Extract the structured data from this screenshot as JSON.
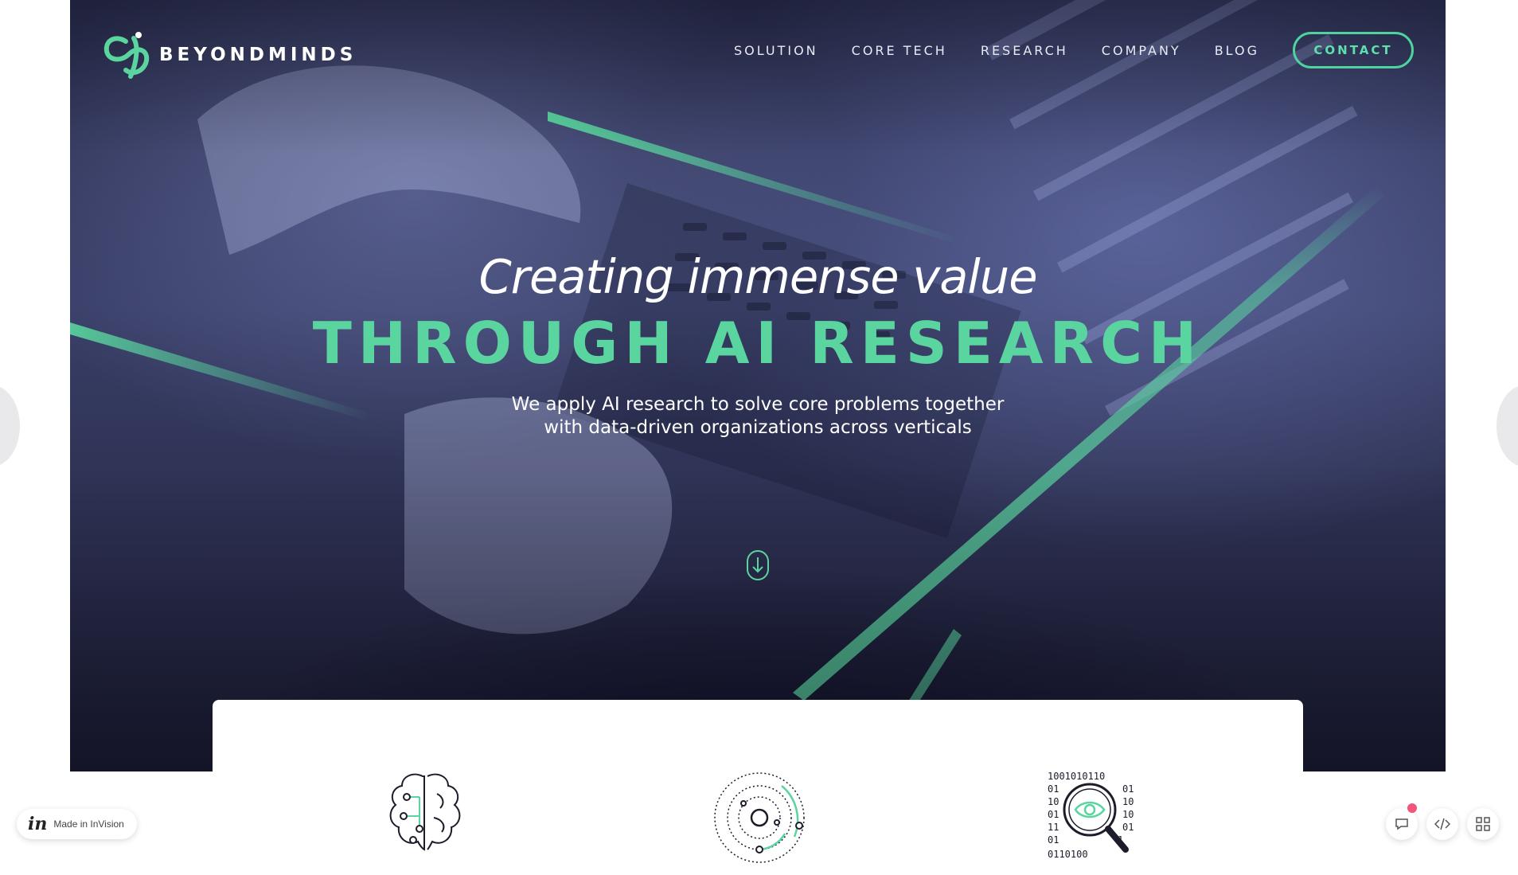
{
  "brand": {
    "name": "BEYONDMINDS",
    "accent_color": "#5ad59f",
    "logo_icon": "beyondminds-logo-icon"
  },
  "nav": {
    "items": [
      {
        "label": "SOLUTION"
      },
      {
        "label": "CORE TECH"
      },
      {
        "label": "RESEARCH"
      },
      {
        "label": "COMPANY"
      },
      {
        "label": "BLOG"
      }
    ],
    "contact_label": "CONTACT"
  },
  "hero": {
    "headline_line1": "Creating immense value",
    "headline_line2": "THROUGH AI RESEARCH",
    "subline_line1": "We apply AI research to solve core problems together",
    "subline_line2": "with data-driven organizations across verticals",
    "scroll_icon": "scroll-down-icon"
  },
  "features": {
    "icons": [
      "brain-circuit-icon",
      "concentric-orbits-icon",
      "binary-magnifier-eye-icon"
    ]
  },
  "invision_badge": {
    "logo": "in",
    "label": "Made in InVision"
  },
  "toolbar": {
    "icons": [
      "comment-icon",
      "code-icon",
      "grid-icon"
    ],
    "notification_color": "#f2547a"
  }
}
